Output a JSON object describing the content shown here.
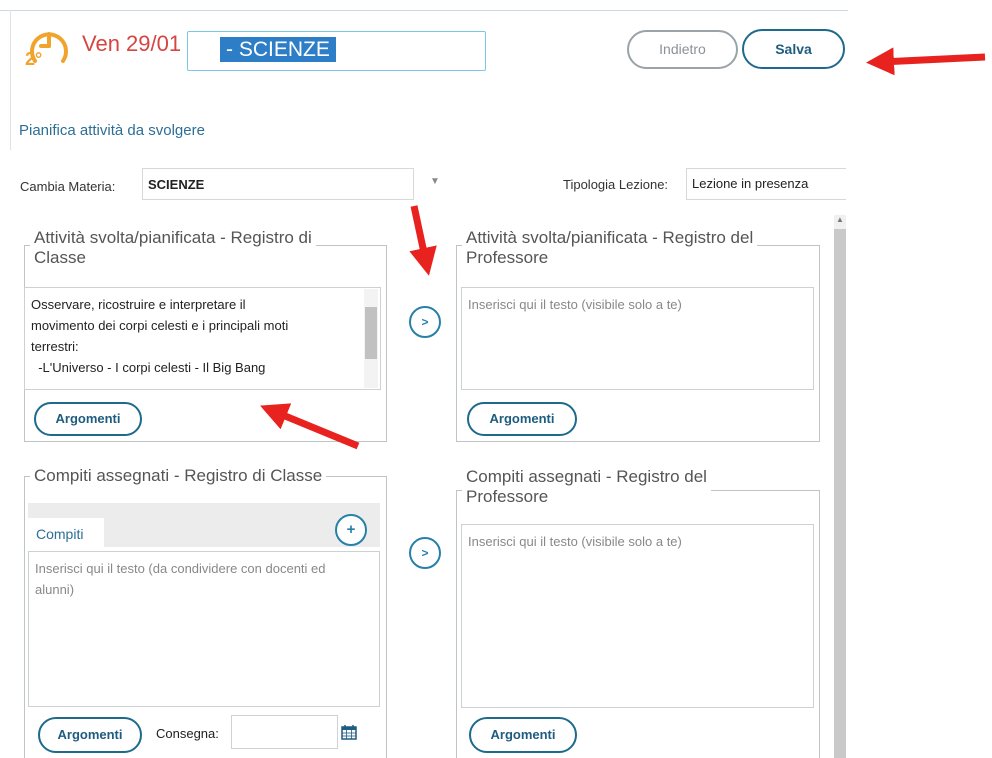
{
  "header": {
    "hour_badge": "2°",
    "date": "Ven 29/01",
    "lesson_title": "- SCIENZE",
    "back_label": "Indietro",
    "save_label": "Salva"
  },
  "subtitle": "Pianifica attività da svolgere",
  "materia": {
    "label": "Cambia Materia:",
    "value": "SCIENZE"
  },
  "tipologia": {
    "label": "Tipologia Lezione:",
    "value": "Lezione in presenza"
  },
  "attivita_classe": {
    "legend_line1": "Attività svolta/pianificata - Registro di",
    "legend_line2": "Classe",
    "text_lines": [
      "Osservare, ricostruire e interpretare il",
      "movimento dei corpi celesti e i principali moti",
      "terrestri:",
      "  -L'Universo - I corpi celesti - Il Big Bang"
    ],
    "argomenti_label": "Argomenti"
  },
  "attivita_professore": {
    "legend_line1": "Attività svolta/pianificata - Registro del",
    "legend_line2": "Professore",
    "placeholder": "Inserisci qui il testo (visibile solo a te)",
    "argomenti_label": "Argomenti"
  },
  "compiti_classe": {
    "legend": "Compiti assegnati - Registro di Classe",
    "tab_label": "Compiti",
    "placeholder_line1": "Inserisci qui il testo (da condividere con docenti ed",
    "placeholder_line2": "alunni)",
    "argomenti_label": "Argomenti",
    "consegna_label": "Consegna:"
  },
  "compiti_professore": {
    "legend_line1": "Compiti assegnati - Registro del",
    "legend_line2": "Professore",
    "placeholder": "Inserisci qui il testo (visibile solo a te)",
    "argomenti_label": "Argomenti"
  },
  "copy_button_glyph": ">",
  "add_button_glyph": "+",
  "icons": [
    "clock-icon",
    "calendar-icon",
    "chevron-down-icon",
    "annotation-arrow"
  ],
  "colors": {
    "accent": "#1e6a8c",
    "date": "#d64541",
    "selection": "#2e7ec7",
    "annotation": "#e8231f"
  }
}
